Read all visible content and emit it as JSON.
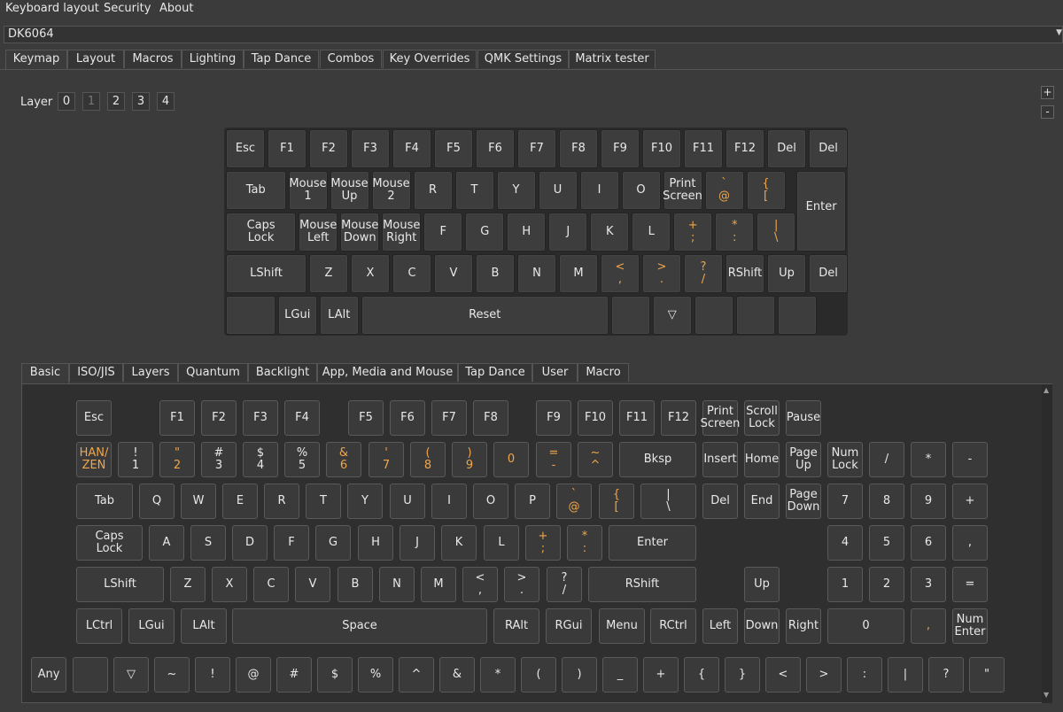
{
  "menubar": [
    "Keyboard layout",
    "Security",
    "About"
  ],
  "device": {
    "selected": "DK6064"
  },
  "main_tabs": [
    "Keymap",
    "Layout",
    "Macros",
    "Lighting",
    "Tap Dance",
    "Combos",
    "Key Overrides",
    "QMK Settings",
    "Matrix tester"
  ],
  "active_main_tab": "Keymap",
  "layer": {
    "label": "Layer",
    "buttons": [
      "0",
      "1",
      "2",
      "3",
      "4"
    ],
    "active": "1"
  },
  "zoom": {
    "plus": "+",
    "minus": "-"
  },
  "keymap_rows": [
    [
      "Esc",
      "F1",
      "F2",
      "F3",
      "F4",
      "F5",
      "F6",
      "F7",
      "F8",
      "F9",
      "F10",
      "F11",
      "F12",
      "Del",
      "Del"
    ],
    [
      "Tab",
      "Mouse\n1",
      "Mouse\nUp",
      "Mouse\n2",
      "R",
      "T",
      "Y",
      "U",
      "I",
      "O",
      "Print\nScreen",
      "`\n@",
      "{\n[",
      "Enter"
    ],
    [
      "Caps\nLock",
      "Mouse\nLeft",
      "Mouse\nDown",
      "Mouse\nRight",
      "F",
      "G",
      "H",
      "J",
      "K",
      "L",
      "+\n;",
      "*\n:",
      "|\n\\"
    ],
    [
      "LShift",
      "Z",
      "X",
      "C",
      "V",
      "B",
      "N",
      "M",
      "<\n,",
      ">\n.",
      "?\n/",
      "RShift",
      "Up",
      "Del"
    ],
    [
      "",
      "LGui",
      "LAlt",
      "Reset",
      "",
      "▽",
      "",
      "",
      ""
    ]
  ],
  "palette_tabs": [
    "Basic",
    "ISO/JIS",
    "Layers",
    "Quantum",
    "Backlight",
    "App, Media and Mouse",
    "Tap Dance",
    "User",
    "Macro"
  ],
  "active_palette_tab": "Basic",
  "palette": {
    "row1": [
      "Esc",
      "F1",
      "F2",
      "F3",
      "F4",
      "F5",
      "F6",
      "F7",
      "F8",
      "F9",
      "F10",
      "F11",
      "F12",
      "Print\nScreen",
      "Scroll\nLock",
      "Pause"
    ],
    "row2": [
      "HAN/\nZEN",
      "!\n1",
      "\"\n2",
      "#\n3",
      "$\n4",
      "%\n5",
      "&\n6",
      "'\n7",
      "(\n8",
      ")\n9",
      "0",
      "=\n-",
      "~\n^",
      "Bksp",
      "Insert",
      "Home",
      "Page\nUp",
      "Num\nLock",
      "/",
      "*",
      "-"
    ],
    "row3": [
      "Tab",
      "Q",
      "W",
      "E",
      "R",
      "T",
      "Y",
      "U",
      "I",
      "O",
      "P",
      "`\n@",
      "{\n[",
      "|\n\\",
      "Del",
      "End",
      "Page\nDown",
      "7",
      "8",
      "9",
      "+"
    ],
    "row4": [
      "Caps\nLock",
      "A",
      "S",
      "D",
      "F",
      "G",
      "H",
      "J",
      "K",
      "L",
      "+\n;",
      "*\n:",
      "Enter",
      "4",
      "5",
      "6",
      ","
    ],
    "row5": [
      "LShift",
      "Z",
      "X",
      "C",
      "V",
      "B",
      "N",
      "M",
      "<\n,",
      ">\n.",
      "?\n/",
      "RShift",
      "Up",
      "1",
      "2",
      "3",
      "="
    ],
    "row6": [
      "LCtrl",
      "LGui",
      "LAlt",
      "Space",
      "RAlt",
      "RGui",
      "Menu",
      "RCtrl",
      "Left",
      "Down",
      "Right",
      "0",
      ",",
      "Num\nEnter"
    ],
    "row7": [
      "Any",
      "",
      "▽",
      "~",
      "!",
      "@",
      "#",
      "$",
      "%",
      "^",
      "&",
      "*",
      "(",
      ")",
      "_",
      "+",
      "{",
      "}",
      "<",
      ">",
      ":",
      "|",
      "?",
      "\""
    ]
  },
  "colors": {
    "background": "#3b3b3b",
    "key": "#3d3d3d",
    "orange_text": "#f0a64a"
  }
}
